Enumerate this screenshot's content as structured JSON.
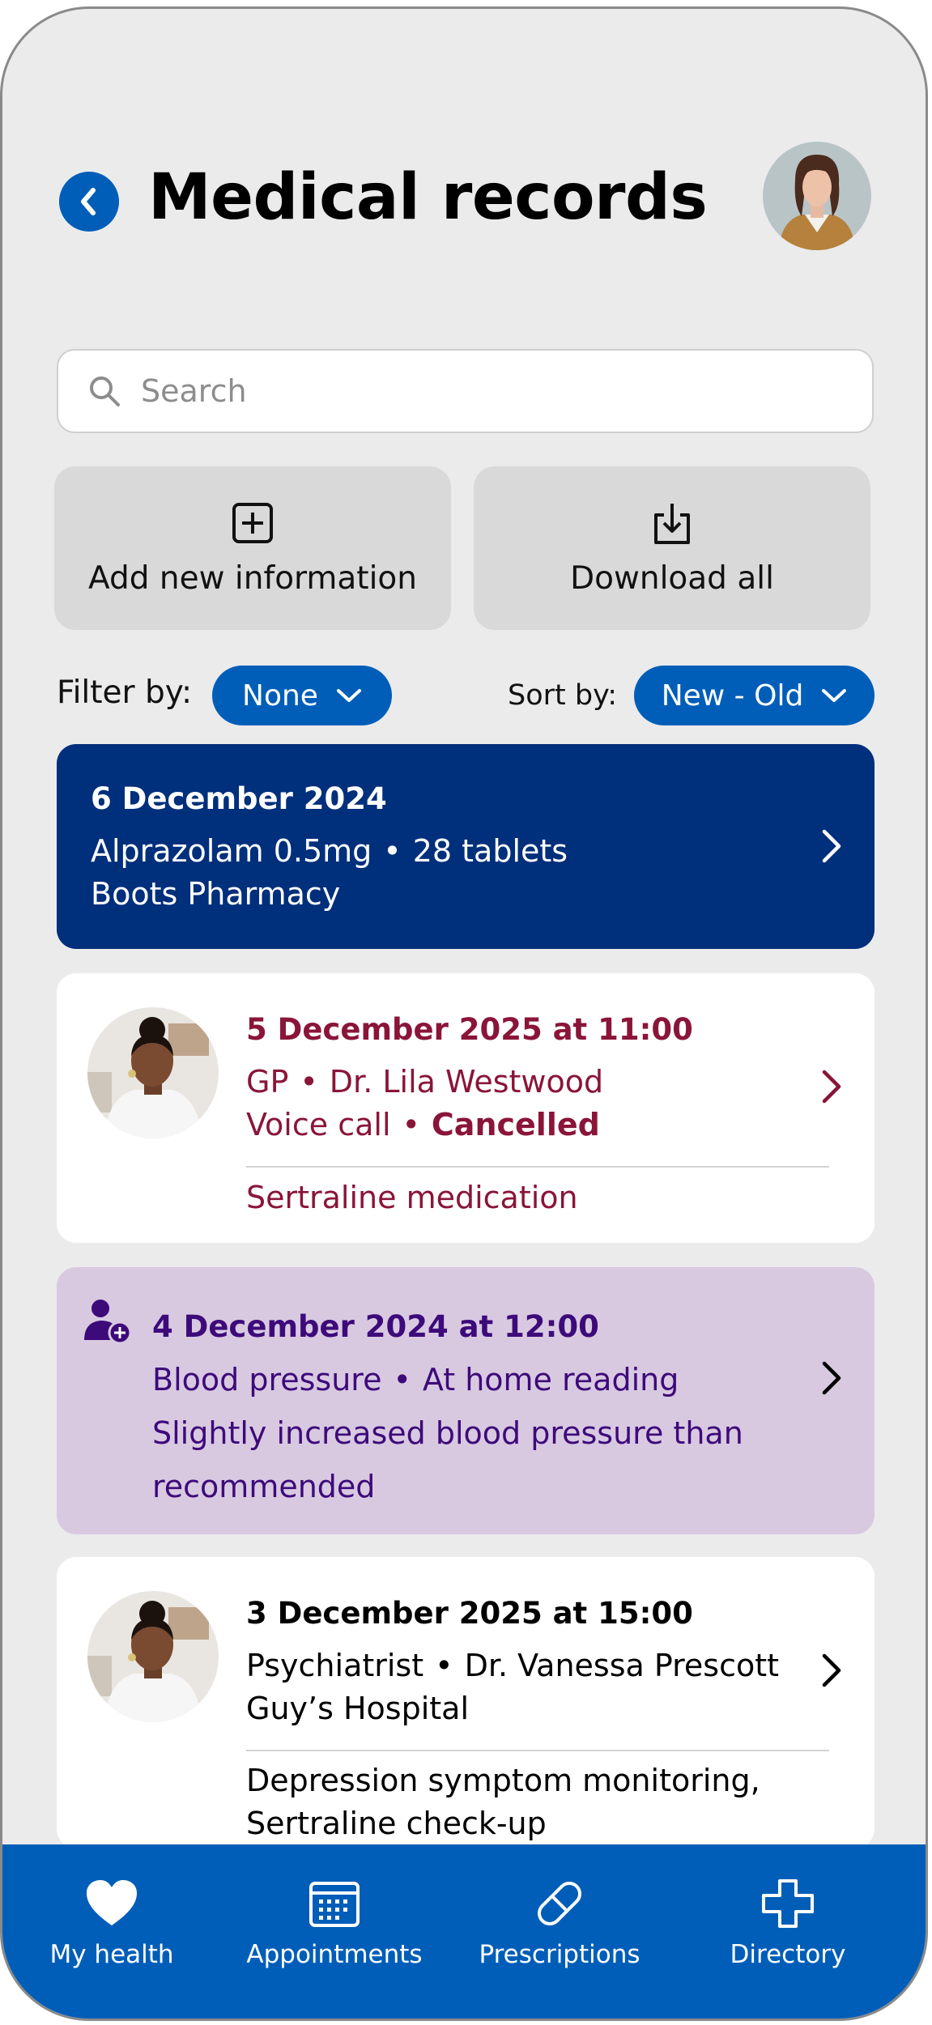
{
  "header": {
    "title": "Medical records"
  },
  "search": {
    "placeholder": "Search"
  },
  "actions": {
    "add_label": "Add new information",
    "download_label": "Download all"
  },
  "filters": {
    "filter_label": "Filter by:",
    "filter_value": "None",
    "sort_label": "Sort by:",
    "sort_value": "New - Old"
  },
  "records": [
    {
      "date": "6 December 2024",
      "line1a": "Alprazolam 0.5mg",
      "line1b": "28 tablets",
      "line2": "Boots Pharmacy"
    },
    {
      "date": "5 December 2025 at 11:00",
      "line1a": "GP",
      "line1b": "Dr. Lila Westwood",
      "line2a": "Voice call",
      "line2b": "Cancelled",
      "note": "Sertraline medication"
    },
    {
      "date": "4 December 2024 at 12:00",
      "line1a": "Blood pressure",
      "line1b": "At home reading",
      "line2": "Slightly increased blood pressure than recommended"
    },
    {
      "date": "3 December 2025 at 15:00",
      "line1a": "Psychiatrist",
      "line1b": "Dr. Vanessa Prescott",
      "line2": "Guy’s Hospital",
      "note": "Depression symptom monitoring, Sertraline check-up"
    }
  ],
  "nav": {
    "items": [
      "My health",
      "Appointments",
      "Prescriptions",
      "Directory"
    ]
  },
  "colors": {
    "brand_blue": "#005eb8",
    "navy_card": "#002f7b",
    "cancelled_maroon": "#8a1538",
    "purple_card": "#d8c9e1",
    "purple_text": "#3d0a7a"
  }
}
